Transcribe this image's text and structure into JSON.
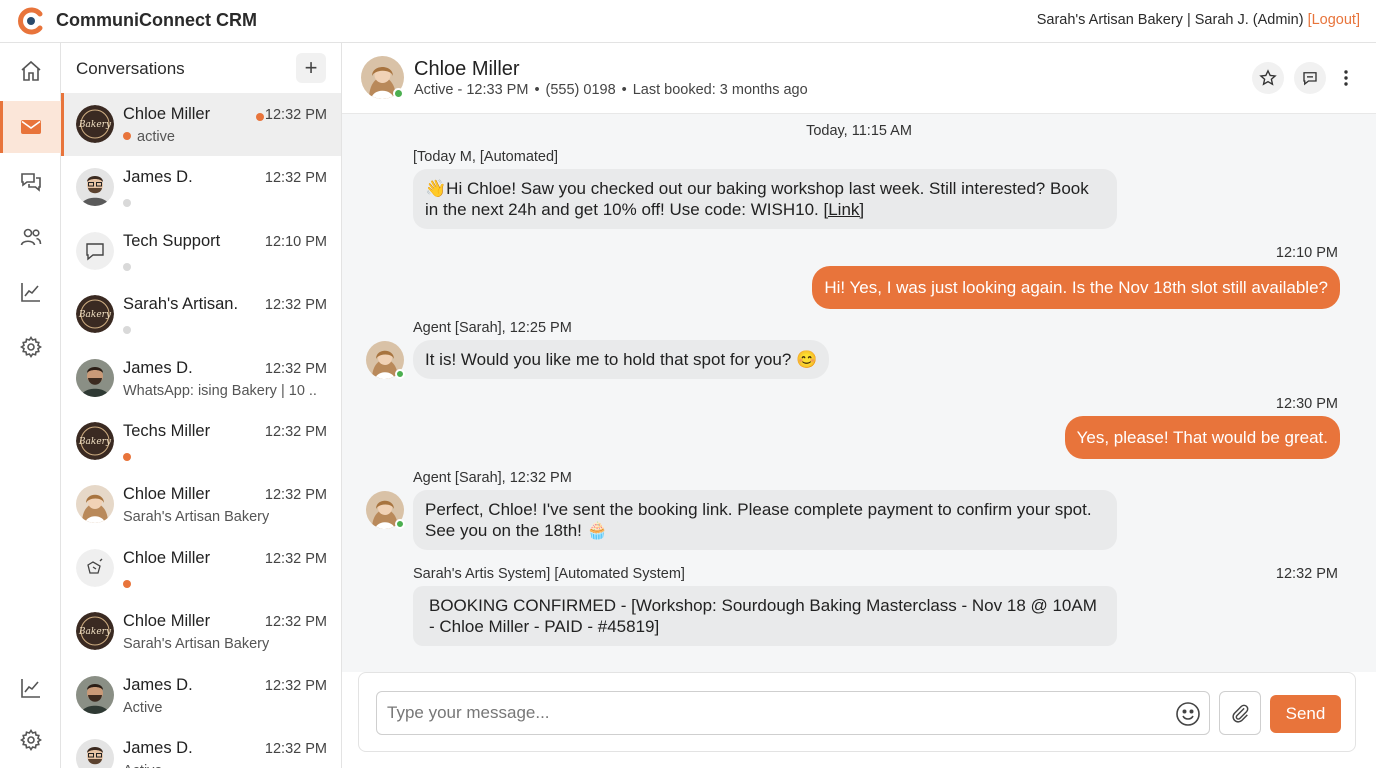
{
  "app": {
    "title": "CommuniConnect CRM",
    "brand_color": "#e8743b"
  },
  "account": {
    "label": "Sarah's Artisan Bakery | Sarah J. (Admin)",
    "logout": "[Logout]"
  },
  "rail": {
    "items": [
      {
        "icon": "home-icon",
        "active": false
      },
      {
        "icon": "mail-icon",
        "active": true
      },
      {
        "icon": "chat-bubbles-icon",
        "active": false
      },
      {
        "icon": "contacts-icon",
        "active": false
      },
      {
        "icon": "analytics-icon",
        "active": false
      },
      {
        "icon": "settings-icon",
        "active": false
      },
      {
        "icon": "analytics-icon",
        "active": false
      },
      {
        "icon": "settings-icon",
        "active": false
      }
    ]
  },
  "conversations": {
    "title": "Conversations",
    "add_label": "+",
    "items": [
      {
        "name": "Chloe Miller",
        "time": "12:32 PM",
        "sub": "active",
        "status": "orange",
        "avatar": "bakery",
        "unread": true,
        "selected": true
      },
      {
        "name": "James D.",
        "time": "12:32 PM",
        "sub": "",
        "status": "grey",
        "avatar": "man-glasses"
      },
      {
        "name": "Tech Support",
        "time": "12:10 PM",
        "sub": "",
        "status": "grey",
        "avatar": "chat-icon"
      },
      {
        "name": "Sarah's Artisan.",
        "time": "12:32 PM",
        "sub": "",
        "status": "grey",
        "avatar": "bakery"
      },
      {
        "name": "James D.",
        "time": "12:32 PM",
        "sub": "WhatsApp: ising Bakery | 10 ..",
        "status": "",
        "avatar": "man-beard"
      },
      {
        "name": "Techs Miller",
        "time": "12:32 PM",
        "sub": "",
        "status": "orange",
        "avatar": "bakery"
      },
      {
        "name": "Chloe Miller",
        "time": "12:32 PM",
        "sub": "Sarah's Artisan Bakery",
        "status": "",
        "avatar": "woman"
      },
      {
        "name": "Chloe Miller",
        "time": "12:32 PM",
        "sub": "",
        "status": "orange",
        "avatar": "robot-icon"
      },
      {
        "name": "Chloe Miller",
        "time": "12:32 PM",
        "sub": "Sarah's Artisan Bakery",
        "status": "",
        "avatar": "bakery"
      },
      {
        "name": "James D.",
        "time": "12:32 PM",
        "sub": "Active",
        "status": "",
        "avatar": "man-beard"
      },
      {
        "name": "James D.",
        "time": "12:32 PM",
        "sub": "Active",
        "status": "",
        "avatar": "man-glasses"
      }
    ]
  },
  "chat": {
    "contact_name": "Chloe Miller",
    "status": "Active - 12:33 PM",
    "phone": "(555) 0198",
    "last_booked": "Last booked: 3 months ago",
    "day_separator": "Today, 11:15 AM",
    "messages": {
      "m1_label": "[Today M, [Automated]",
      "m1_text_a": "👋Hi Chloe! Saw you checked out our baking workshop last week. Still interested? Book in the next 24h and get 10% off! Use code: WISH10. ",
      "m1_link": "[Link]",
      "m2_time": "12:10 PM",
      "m2_text": "Hi! Yes, I was just looking again. Is the Nov 18th slot still available?",
      "m3_label": "Agent [Sarah],  12:25 PM",
      "m3_text": "It is! Would you like me to hold that spot for you? 😊",
      "m4_time": "12:30 PM",
      "m4_text": "Yes, please! That would be great.",
      "m5_label": "Agent [Sarah],  12:32 PM",
      "m5_text": "Perfect, Chloe! I've sent the booking link. Please complete payment to confirm your spot. See you on the 18th! 🧁",
      "m6_label": "Sarah's Artis System] [Automated System]",
      "m6_time": "12:32 PM",
      "m6_text": "BOOKING CONFIRMED - [Workshop: Sourdough Baking Masterclass - Nov 18 @ 10AM - Chloe Miller - PAID - #45819]"
    },
    "composer": {
      "placeholder": "Type your message...",
      "send_label": "Send"
    }
  }
}
